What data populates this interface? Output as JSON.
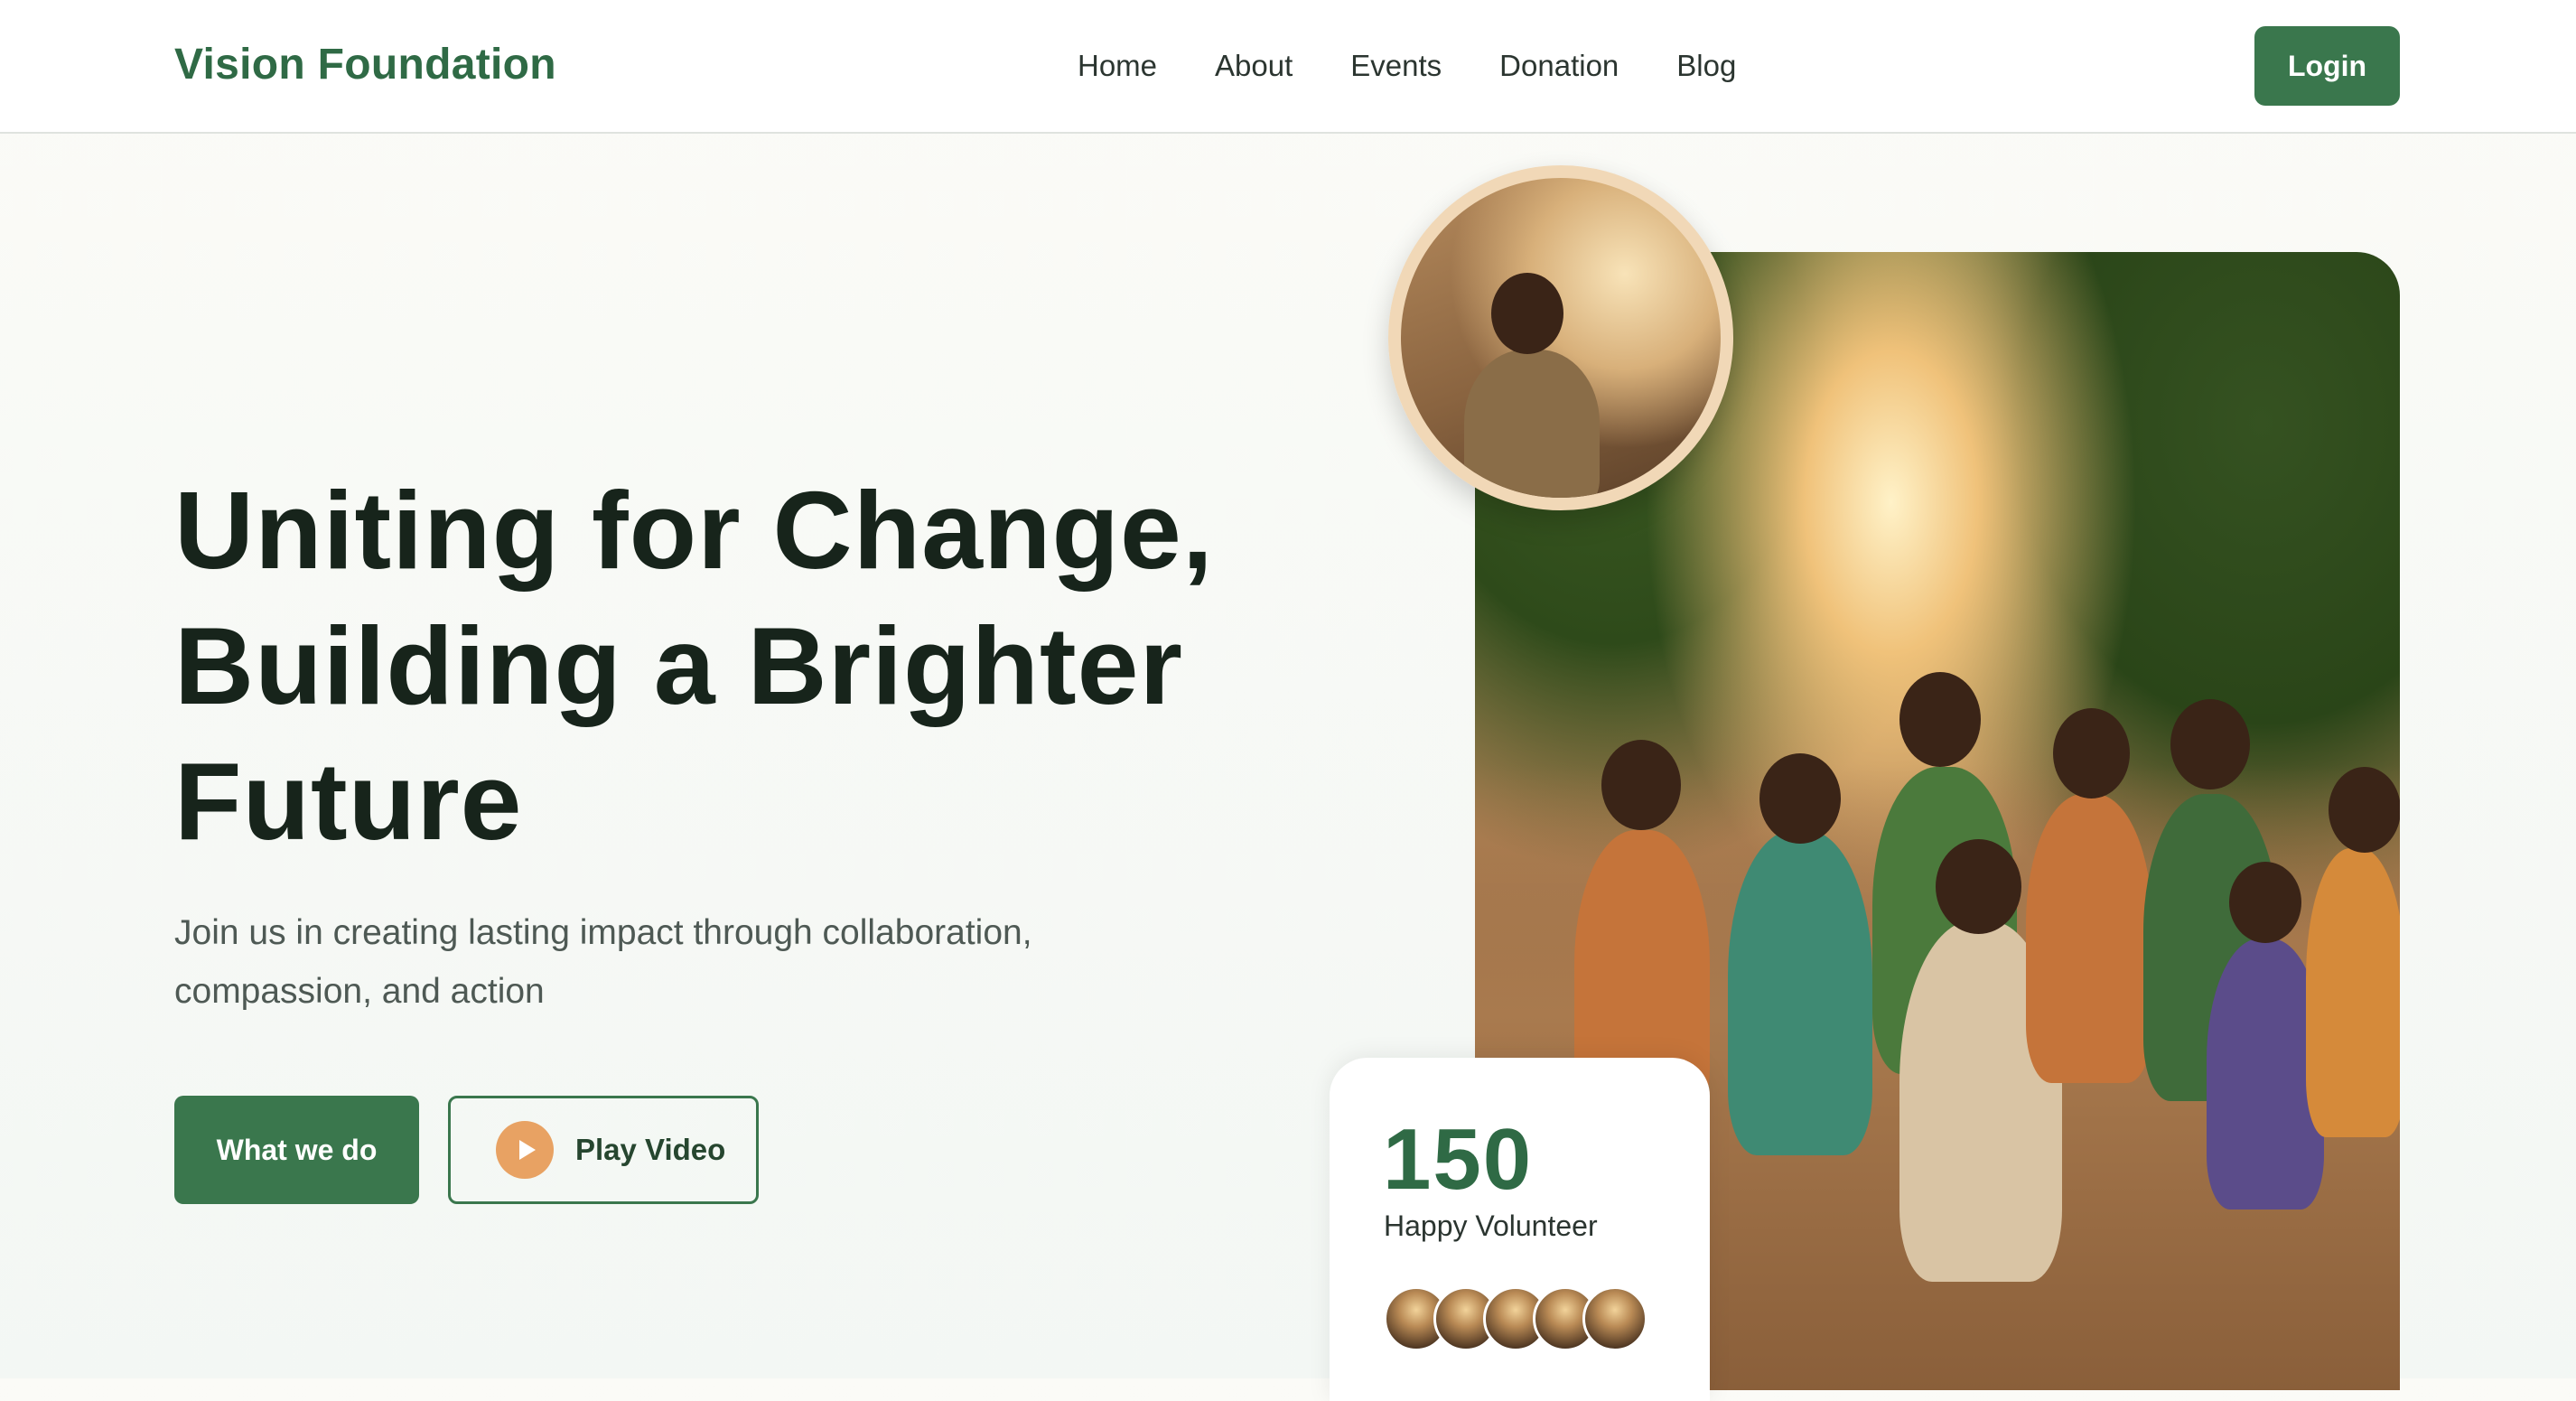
{
  "header": {
    "logo": "Vision Foundation",
    "nav": [
      "Home",
      "About",
      "Events",
      "Donation",
      "Blog"
    ],
    "login_label": "Login"
  },
  "hero": {
    "headline_line1": "Uniting for Change,",
    "headline_line2": "Building a Brighter",
    "headline_line3": "Future",
    "subtitle_line1": "Join us in creating lasting impact through collaboration,",
    "subtitle_line2": "compassion, and action",
    "primary_button": "What we do",
    "video_button": "Play Video"
  },
  "stats": {
    "number": "150",
    "label": "Happy Volunteer",
    "avatar_count": 5
  },
  "colors": {
    "brand_green": "#3a774d",
    "accent_orange": "#e8a263",
    "ring_beige": "#f1d8b7"
  },
  "icons": {
    "play": "play-icon"
  }
}
